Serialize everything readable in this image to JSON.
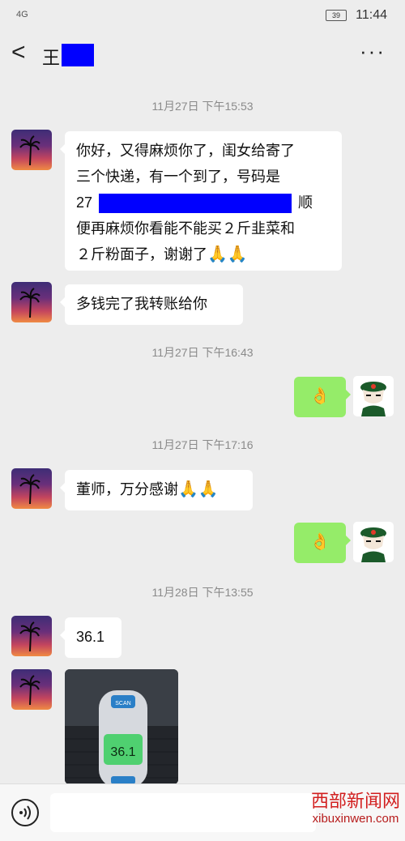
{
  "status_bar": {
    "left": "4G",
    "battery": "39",
    "time": "11:44"
  },
  "header": {
    "back_label": "<",
    "contact_name": "王",
    "more_label": "···"
  },
  "timestamps": [
    "11月27日 下午15:53",
    "11月27日 下午16:43",
    "11月27日 下午17:16",
    "11月28日 下午13:55"
  ],
  "messages": [
    {
      "text_l1": "你好，又得麻烦你了，闺女给寄了",
      "text_l2": "三个快递，有一个到了，号码是",
      "text_l3_prefix": "27",
      "text_l3_suffix": "顺",
      "text_l4": "便再麻烦你看能不能买２斤韭菜和",
      "text_l5": "２斤粉面子，谢谢了",
      "emoji": "🙏🙏"
    },
    {
      "text": "多钱完了我转账给你"
    },
    {
      "emoji": "👌"
    },
    {
      "text": "董师，万分感谢",
      "emoji": "🙏🙏"
    },
    {
      "emoji": "👌"
    },
    {
      "text": "36.1"
    }
  ],
  "photo": {
    "scan_label": "SCAN",
    "reading": "36.1"
  },
  "composer": {
    "voice_icon": "voice-icon"
  },
  "watermark": {
    "line1": "西部新闻网",
    "line2": "xibuxinwen.com"
  }
}
